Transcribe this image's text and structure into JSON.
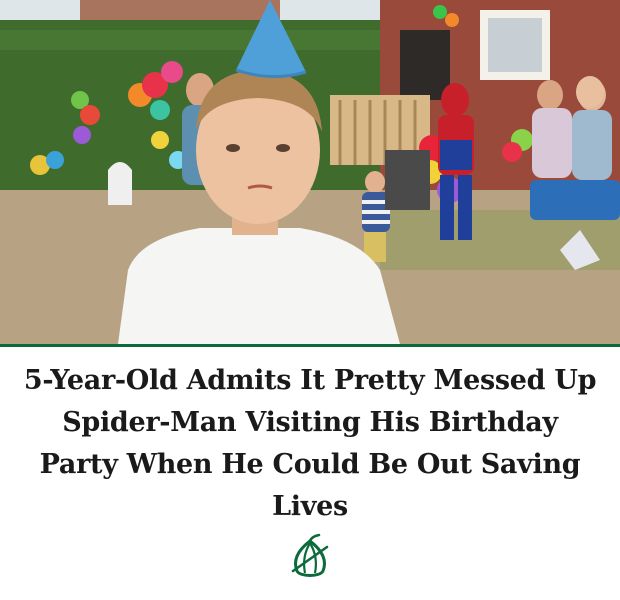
{
  "article": {
    "headline": "5-Year-Old Admits It Pretty Messed Up Spider-Man Visiting His Birthday Party When He Could Be Out Saving Lives",
    "accent_color": "#0b6b3a"
  },
  "photo": {
    "subject": "party-photo-boy-with-hat-and-spider-man"
  },
  "logo": {
    "icon": "onion-icon",
    "color": "#0b6b3a"
  }
}
